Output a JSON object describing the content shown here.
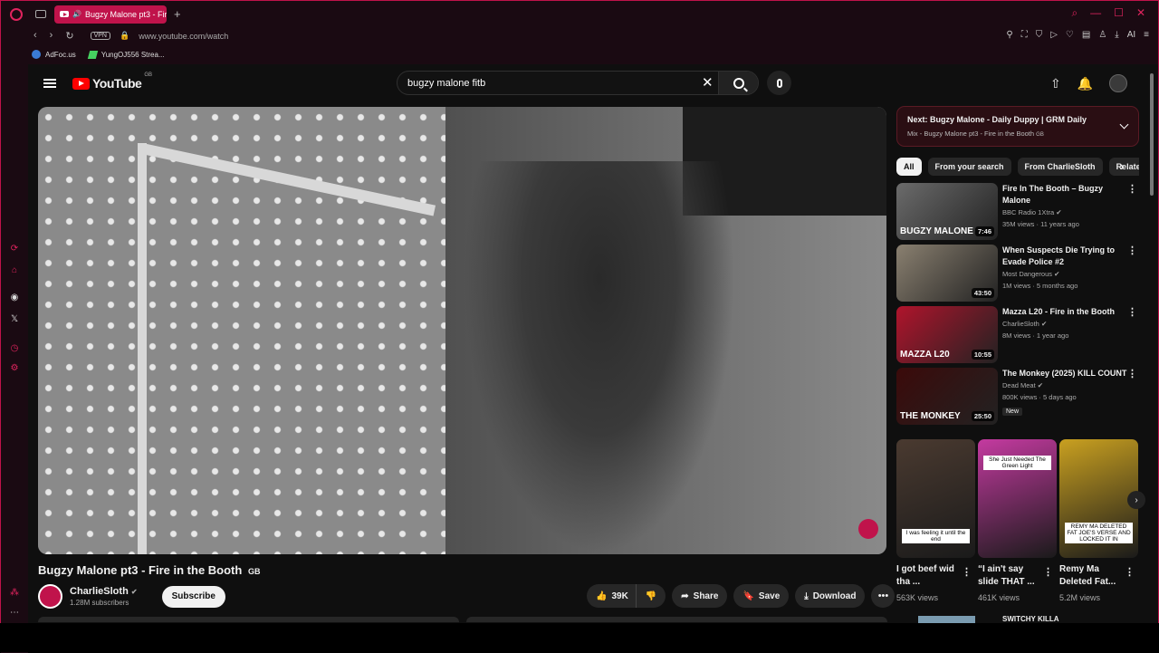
{
  "browser": {
    "tab_title": "Bugzy Malone pt3 - Fire",
    "url": "www.youtube.com/watch",
    "vpn_label": "VPN",
    "bookmarks": [
      {
        "label": "AdFoc.us",
        "icon": "adfocus-icon"
      },
      {
        "label": "YungOJ556 Strea...",
        "icon": "kick-icon"
      }
    ],
    "ai_label": "AI",
    "new_tab": "+"
  },
  "youtube": {
    "logo_text": "YouTube",
    "region": "GB",
    "search": {
      "value": "bugzy malone fitb",
      "placeholder": "Search"
    }
  },
  "video": {
    "title": "Bugzy Malone pt3 - Fire in the Booth",
    "title_badge": "GB",
    "channel": "CharlieSloth",
    "subscribers": "1.28M subscribers",
    "subscribe_label": "Subscribe",
    "likes": "39K",
    "share_label": "Share",
    "save_label": "Save",
    "download_label": "Download"
  },
  "up_next": {
    "line1": "Next: Bugzy Malone - Daily Duppy | GRM Daily",
    "line2": "Mix - Bugzy Malone pt3 - Fire in the Booth",
    "line2_badge": "GB"
  },
  "chips": [
    "All",
    "From your search",
    "From CharlieSloth",
    "Related"
  ],
  "recommendations": [
    {
      "title": "Fire In The Booth – Bugzy Malone",
      "channel": "BBC Radio 1Xtra",
      "verified": true,
      "views": "35M views · 11 years ago",
      "duration": "7:46",
      "thumb_color": "#6b6b6b",
      "thumb_text": "BUGZY MALONE",
      "badge": ""
    },
    {
      "title": "When Suspects Die Trying to Evade Police #2",
      "channel": "Most Dangerous",
      "verified": true,
      "views": "1M views · 5 months ago",
      "duration": "43:50",
      "thumb_color": "#8a8070",
      "thumb_text": "",
      "badge": ""
    },
    {
      "title": "Mazza L20 - Fire in the Booth",
      "channel": "CharlieSloth",
      "verified": true,
      "views": "8M views · 1 year ago",
      "duration": "10:55",
      "thumb_color": "#b0142c",
      "thumb_text": "MAZZA L20",
      "badge": ""
    },
    {
      "title": "The Monkey (2025) KILL COUNT",
      "channel": "Dead Meat",
      "verified": true,
      "views": "800K views · 5 days ago",
      "duration": "25:50",
      "thumb_color": "#3b0a0a",
      "thumb_text": "THE MONKEY",
      "badge": "New"
    }
  ],
  "shorts": [
    {
      "title": "I got beef wid tha ...",
      "views": "563K views",
      "caption": "I was feeling it until the end",
      "top_caption": "",
      "color": "#4a3a30"
    },
    {
      "title": "“I ain't say slide THAT ...",
      "views": "461K views",
      "caption": "",
      "top_caption": "She Just Needed The Green Light",
      "color": "#c43aa0"
    },
    {
      "title": "Remy Ma Deleted Fat...",
      "views": "5.2M views",
      "caption": "REMY MA DELETED FAT JOE'S VERSE AND LOCKED IT IN",
      "top_caption": "",
      "color": "#c9a020"
    }
  ],
  "last_rec": {
    "title": "SWITCHY KILLA"
  },
  "colors": {
    "accent": "#c0134b",
    "youtube_red": "#ff0000",
    "background": "#0f0f0f"
  }
}
